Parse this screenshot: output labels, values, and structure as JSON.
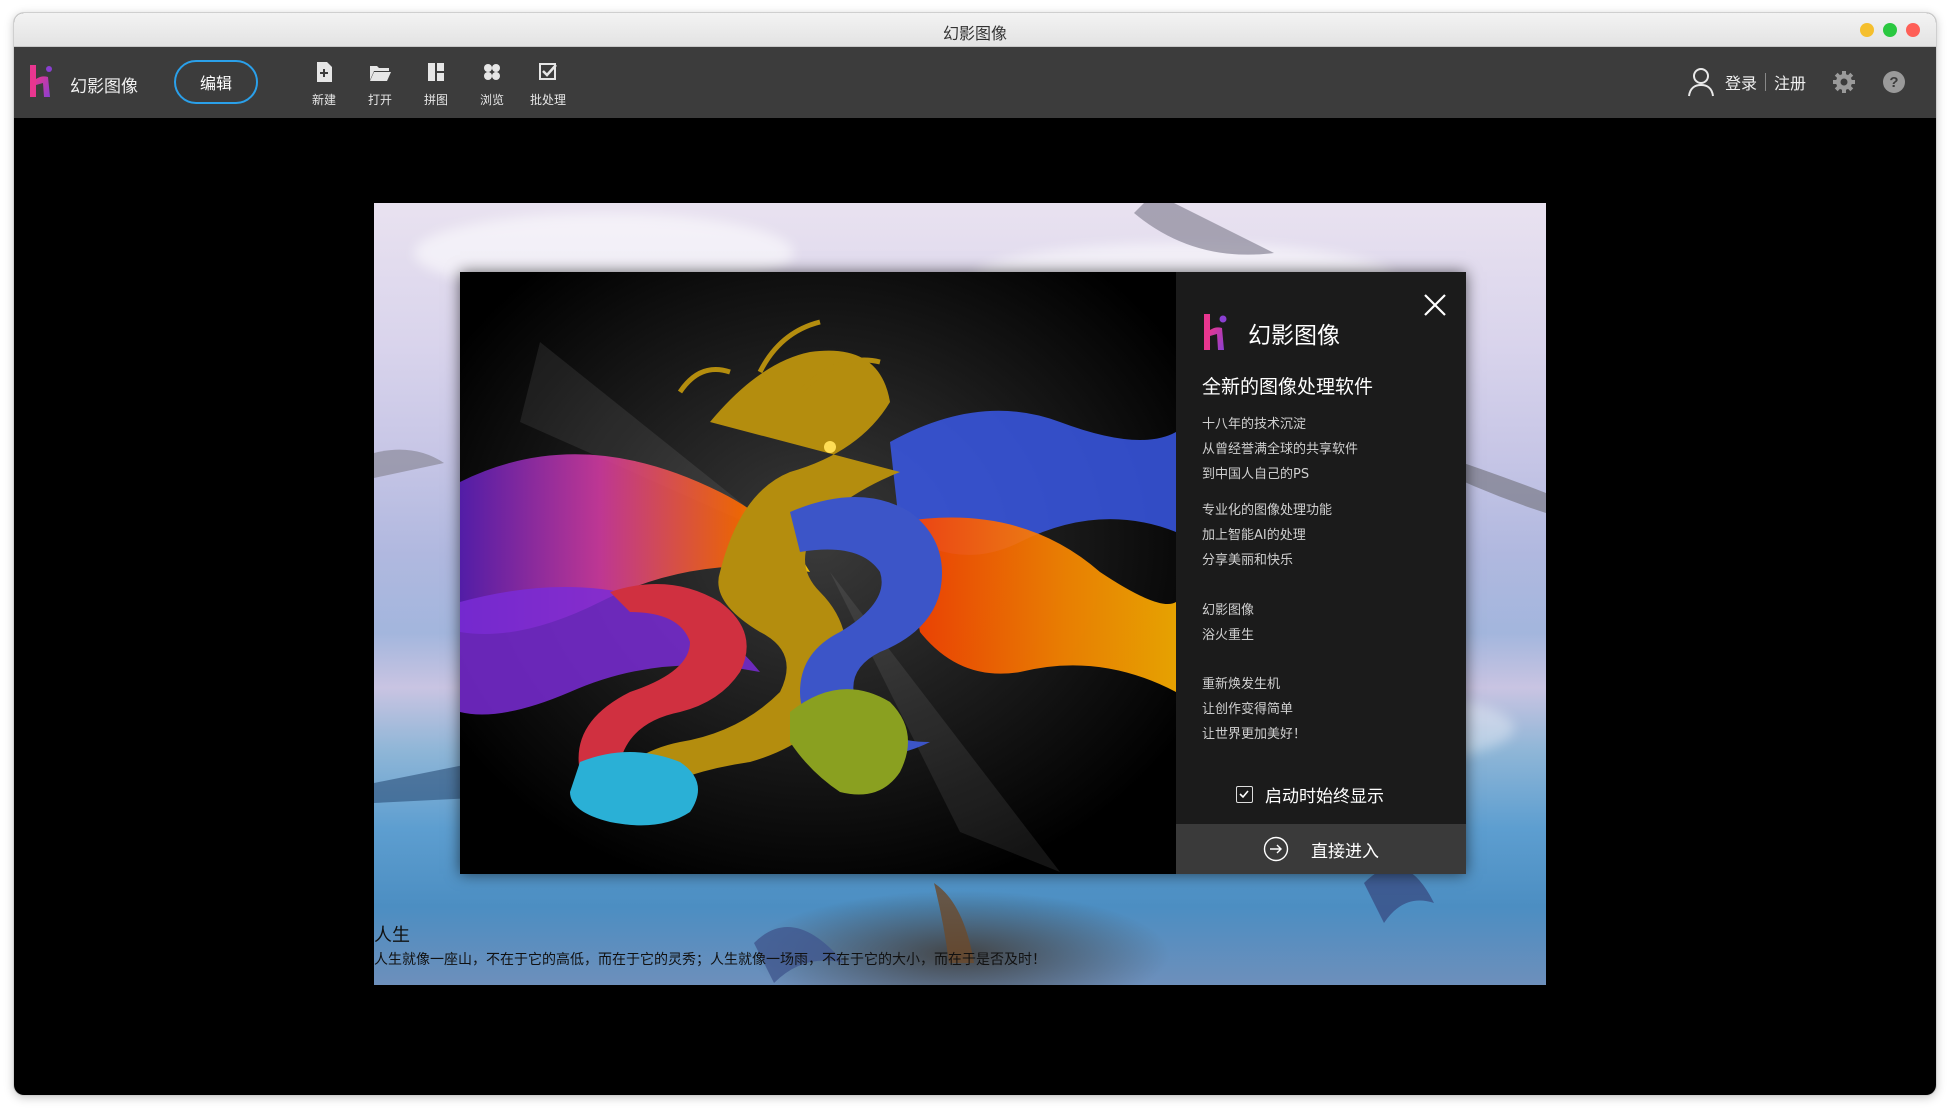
{
  "window": {
    "title": "幻影图像"
  },
  "toolbar": {
    "app_name": "幻影图像",
    "edit_label": "编辑",
    "tools": [
      {
        "label": "新建",
        "icon": "new-file-icon"
      },
      {
        "label": "打开",
        "icon": "folder-open-icon"
      },
      {
        "label": "拼图",
        "icon": "collage-icon"
      },
      {
        "label": "浏览",
        "icon": "browse-icon"
      },
      {
        "label": "批处理",
        "icon": "batch-icon"
      }
    ],
    "login_label": "登录",
    "register_label": "注册"
  },
  "caption": {
    "title": "人生",
    "text": "人生就像一座山，不在于它的高低，而在于它的灵秀；人生就像一场雨，不在于它的大小，而在于是否及时！"
  },
  "dialog": {
    "app_name": "幻影图像",
    "tagline": "全新的图像处理软件",
    "paragraphs": [
      [
        "十八年的技术沉淀",
        "从曾经誉满全球的共享软件",
        "到中国人自己的PS"
      ],
      [
        "专业化的图像处理功能",
        "加上智能AI的处理",
        "分享美丽和快乐"
      ],
      [
        "幻影图像",
        "浴火重生"
      ],
      [
        "重新焕发生机",
        "让创作变得简单",
        "让世界更加美好！"
      ]
    ],
    "checkbox_label": "启动时始终显示",
    "checkbox_checked": true,
    "enter_label": "直接进入"
  },
  "colors": {
    "accent": "#2aa0ea",
    "toolbar_bg": "#3c3c3c",
    "logo_pink": "#e8368f",
    "logo_purple": "#8a3fd1"
  }
}
